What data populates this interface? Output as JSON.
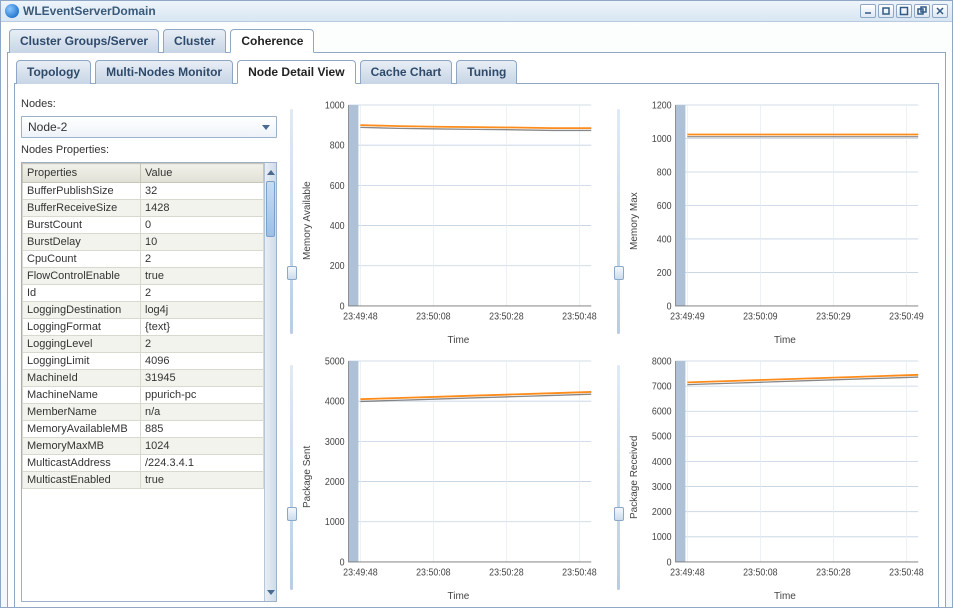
{
  "window": {
    "title": "WLEventServerDomain"
  },
  "outerTabs": {
    "items": [
      {
        "label": "Cluster Groups/Server"
      },
      {
        "label": "Cluster"
      },
      {
        "label": "Coherence"
      }
    ],
    "active": 2
  },
  "innerTabs": {
    "items": [
      {
        "label": "Topology"
      },
      {
        "label": "Multi-Nodes Monitor"
      },
      {
        "label": "Node Detail View"
      },
      {
        "label": "Cache Chart"
      },
      {
        "label": "Tuning"
      }
    ],
    "active": 2
  },
  "left": {
    "nodes_label": "Nodes:",
    "node_selected": "Node-2",
    "props_label": "Nodes Properties:",
    "grid_headers": {
      "prop": "Properties",
      "val": "Value"
    },
    "rows": [
      {
        "p": "BufferPublishSize",
        "v": "32"
      },
      {
        "p": "BufferReceiveSize",
        "v": "1428"
      },
      {
        "p": "BurstCount",
        "v": "0"
      },
      {
        "p": "BurstDelay",
        "v": "10"
      },
      {
        "p": "CpuCount",
        "v": "2"
      },
      {
        "p": "FlowControlEnable",
        "v": "true"
      },
      {
        "p": "Id",
        "v": "2"
      },
      {
        "p": "LoggingDestination",
        "v": "log4j"
      },
      {
        "p": "LoggingFormat",
        "v": "{text}"
      },
      {
        "p": "LoggingLevel",
        "v": "2"
      },
      {
        "p": "LoggingLimit",
        "v": "4096"
      },
      {
        "p": "MachineId",
        "v": "31945"
      },
      {
        "p": "MachineName",
        "v": "ppurich-pc"
      },
      {
        "p": "MemberName",
        "v": "n/a"
      },
      {
        "p": "MemoryAvailableMB",
        "v": "885"
      },
      {
        "p": "MemoryMaxMB",
        "v": "1024"
      },
      {
        "p": "MulticastAddress",
        "v": "/224.3.4.1"
      },
      {
        "p": "MulticastEnabled",
        "v": "true"
      }
    ]
  },
  "chart_data": [
    {
      "type": "line",
      "title": "",
      "xlabel": "Time",
      "ylabel": "Memory Available",
      "xticks": [
        "23:49:48",
        "23:50:08",
        "23:50:28",
        "23:50:48"
      ],
      "yticks": [
        0,
        200,
        400,
        600,
        800,
        1000
      ],
      "ylim": [
        0,
        1000
      ],
      "series": [
        {
          "name": "mem_avail",
          "color": "#ff8c1a",
          "values": [
            900,
            895,
            892,
            890,
            888,
            885,
            885
          ]
        }
      ]
    },
    {
      "type": "line",
      "title": "",
      "xlabel": "Time",
      "ylabel": "Memory Max",
      "xticks": [
        "23:49:49",
        "23:50:09",
        "23:50:29",
        "23:50:49"
      ],
      "yticks": [
        0,
        200,
        400,
        600,
        800,
        1000,
        1200
      ],
      "ylim": [
        0,
        1200
      ],
      "series": [
        {
          "name": "mem_max",
          "color": "#ff8c1a",
          "values": [
            1024,
            1024,
            1024,
            1024,
            1024,
            1024,
            1024
          ]
        }
      ]
    },
    {
      "type": "line",
      "title": "",
      "xlabel": "Time",
      "ylabel": "Package Sent",
      "xticks": [
        "23:49:48",
        "23:50:08",
        "23:50:28",
        "23:50:48"
      ],
      "yticks": [
        0,
        1000,
        2000,
        3000,
        4000,
        5000
      ],
      "ylim": [
        0,
        5000
      ],
      "series": [
        {
          "name": "pkg_sent",
          "color": "#ff8c1a",
          "values": [
            4050,
            4080,
            4110,
            4140,
            4170,
            4200,
            4230
          ]
        }
      ]
    },
    {
      "type": "line",
      "title": "",
      "xlabel": "Time",
      "ylabel": "Package Received",
      "xticks": [
        "23:49:48",
        "23:50:08",
        "23:50:28",
        "23:50:48"
      ],
      "yticks": [
        0,
        1000,
        2000,
        3000,
        4000,
        5000,
        6000,
        7000,
        8000
      ],
      "ylim": [
        0,
        8000
      ],
      "series": [
        {
          "name": "pkg_recv",
          "color": "#ff8c1a",
          "values": [
            7150,
            7200,
            7250,
            7300,
            7350,
            7400,
            7450
          ]
        }
      ]
    }
  ]
}
